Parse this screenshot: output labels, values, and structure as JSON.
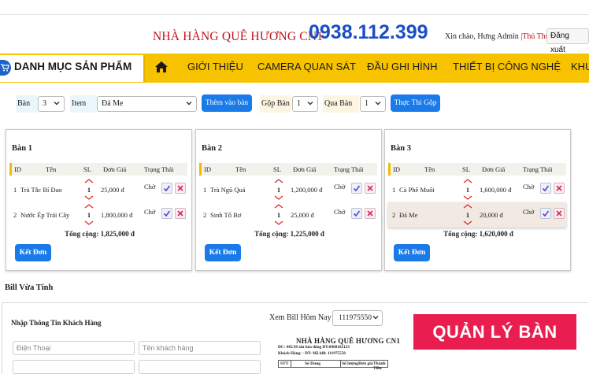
{
  "header": {
    "restaurant": "NHÀ HÀNG QUÊ HƯƠNG CN1",
    "phone": "0938.112.399",
    "greeting": "Xin chào, Hưng Admin ",
    "user_link": "|Thủ Thuật",
    "logout": "Đăng xuất"
  },
  "nav": {
    "category": "DANH MỤC SẢN PHẨM",
    "items": [
      "GIỚI THIỆU",
      "CAMERA QUAN SÁT",
      "ĐẦU GHI HÌNH",
      "THIẾT BỊ CÔNG NGHỆ",
      "KHU"
    ]
  },
  "controls": {
    "ban_label": "Bàn",
    "ban_value": "3",
    "item_label": "Item",
    "item_value": "Đá Me",
    "add_button": "Thêm vào bàn",
    "gop_label": "Gộp Bàn",
    "gop_value": "1",
    "qua_label": "Qua Bàn",
    "qua_value": "1",
    "merge_button": "Thực Thi Gộp"
  },
  "table_headers": {
    "id": "ID",
    "name": "Tên",
    "qty": "SL",
    "price": "Đơn Giá",
    "status": "Trạng Thái"
  },
  "tables": [
    {
      "title": "Bàn 1",
      "rows": [
        {
          "id": "1",
          "name": "Trà Tắc Bí Đao",
          "qty": "1",
          "price": "25,000 đ",
          "status": "Chờ"
        },
        {
          "id": "2",
          "name": "Nước Ép Trái Cây",
          "qty": "1",
          "price": "1,800,000 đ",
          "status": "Chờ"
        }
      ],
      "total": "Tổng cộng: 1,825,000 đ",
      "button": "Kết Đơn"
    },
    {
      "title": "Bàn 2",
      "rows": [
        {
          "id": "1",
          "name": "Trà Ngũ Quả",
          "qty": "1",
          "price": "1,200,000 đ",
          "status": "Chờ"
        },
        {
          "id": "2",
          "name": "Sinh Tố Bơ",
          "qty": "1",
          "price": "25,000 đ",
          "status": "Chờ"
        }
      ],
      "total": "Tổng cộng: 1,225,000 đ",
      "button": "Kết Đơn"
    },
    {
      "title": "Bàn 3",
      "rows": [
        {
          "id": "1",
          "name": "Cà Phê Muối",
          "qty": "1",
          "price": "1,600,000 đ",
          "status": "Chờ"
        },
        {
          "id": "2",
          "name": "Đá Me",
          "qty": "1",
          "price": "20,000 đ",
          "status": "Chờ"
        }
      ],
      "total": "Tổng cộng: 1,620,000 đ",
      "button": "Kết Đơn"
    }
  ],
  "bill": {
    "section_title": "Bill Vừa Tính",
    "customer_title": "Nhập Thông Tin Khách Hàng",
    "phone_placeholder": "Điện Thoại",
    "name_placeholder": "Tên khách hàng",
    "view_label": "Xem Bill Hôm Nay :",
    "view_value": "111975550",
    "receipt_name": "NHÀ HÀNG QUÊ HƯƠNG CN1",
    "receipt_line1": "DC: 445/38 tân hóa đông DT:0968102123",
    "receipt_line2": "Khách Hàng: · DT: Mã bill: 111975550",
    "receipt_cols": [
      "STT",
      "Sô Dung",
      "Số lượng",
      "Đơn giá",
      "Thành Tiền"
    ],
    "manage_button": "QUẢN LÝ BÀN"
  },
  "colors": {
    "brand_red": "#c0121b",
    "phone_blue": "#1a4dc6",
    "nav_yellow": "#f7c200",
    "button_blue": "#1a7ae8",
    "manage_pink": "#e91d4f"
  }
}
